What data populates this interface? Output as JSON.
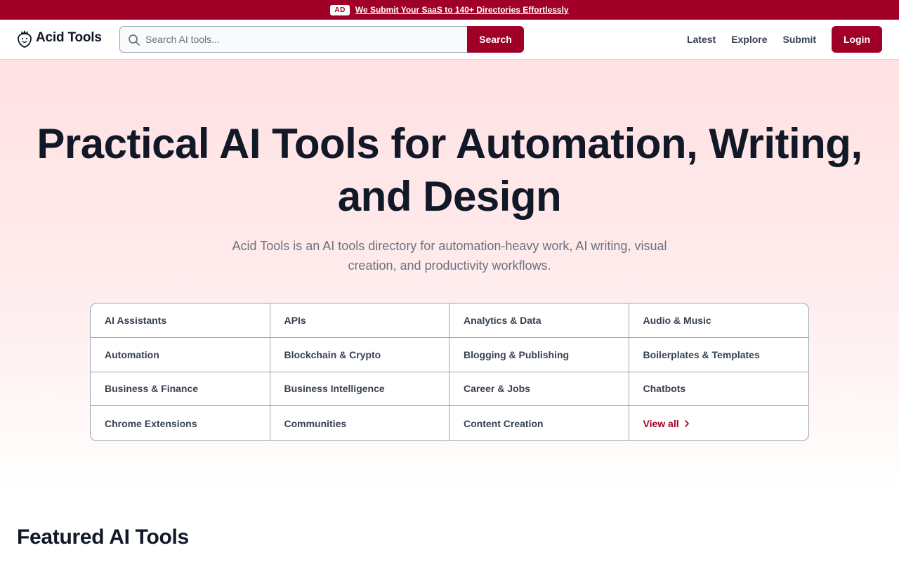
{
  "ad_banner": {
    "badge": "AD",
    "link_text": "We Submit Your SaaS to 140+ Directories Effortlessly",
    "background_color": "#a00028"
  },
  "header": {
    "logo_text": "Acid Tools",
    "logo_icon": "strawberry-icon",
    "search": {
      "placeholder": "Search AI tools...",
      "value": "",
      "button_label": "Search",
      "icon": "search-icon"
    },
    "nav": {
      "latest": "Latest",
      "explore": "Explore",
      "submit": "Submit",
      "login": "Login"
    }
  },
  "hero": {
    "title": "Practical AI Tools for Automation, Writing, and Design",
    "subtitle": "Acid Tools is an AI tools directory for automation-heavy work, AI writing, visual creation, and productivity workflows."
  },
  "categories": {
    "items": [
      "AI Assistants",
      "APIs",
      "Analytics & Data",
      "Audio & Music",
      "Automation",
      "Blockchain & Crypto",
      "Blogging & Publishing",
      "Boilerplates & Templates",
      "Business & Finance",
      "Business Intelligence",
      "Career & Jobs",
      "Chatbots",
      "Chrome Extensions",
      "Communities",
      "Content Creation"
    ],
    "view_all": "View all",
    "view_all_icon": "chevron-right-icon"
  },
  "featured": {
    "title": "Featured AI Tools"
  },
  "colors": {
    "brand": "#a00028",
    "text_dark": "#111827",
    "text_muted": "#6b7280",
    "hero_bg_top": "#ffe1e3"
  }
}
